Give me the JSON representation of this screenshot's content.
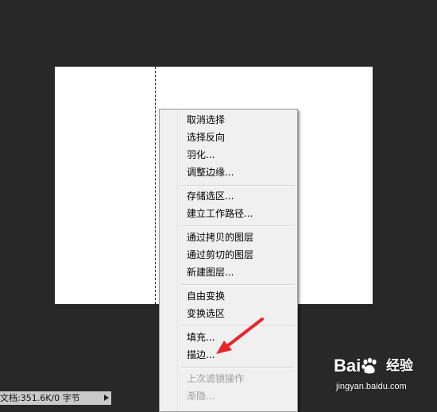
{
  "context_menu": {
    "groups": [
      {
        "items": [
          {
            "label": "取消选择",
            "enabled": true
          },
          {
            "label": "选择反向",
            "enabled": true
          },
          {
            "label": "羽化...",
            "enabled": true
          },
          {
            "label": "调整边缘...",
            "enabled": true
          }
        ]
      },
      {
        "items": [
          {
            "label": "存储选区...",
            "enabled": true
          },
          {
            "label": "建立工作路径...",
            "enabled": true
          }
        ]
      },
      {
        "items": [
          {
            "label": "通过拷贝的图层",
            "enabled": true
          },
          {
            "label": "通过剪切的图层",
            "enabled": true
          },
          {
            "label": "新建图层...",
            "enabled": true
          }
        ]
      },
      {
        "items": [
          {
            "label": "自由变换",
            "enabled": true
          },
          {
            "label": "变换选区",
            "enabled": true
          }
        ]
      },
      {
        "items": [
          {
            "label": "填充...",
            "enabled": true
          },
          {
            "label": "描边...",
            "enabled": true
          }
        ]
      },
      {
        "items": [
          {
            "label": "上次滤镜操作",
            "enabled": false
          },
          {
            "label": "渐隐...",
            "enabled": false
          }
        ]
      }
    ]
  },
  "status_bar": {
    "text": "文档:351.6K/0 字节"
  },
  "watermark": {
    "brand": "Bai",
    "name_cn": "经验",
    "url": "jingyan.baidu.com"
  },
  "colors": {
    "workspace_bg": "#282828",
    "menu_bg": "#f0f0f0",
    "annotation_arrow": "#e8252e"
  }
}
